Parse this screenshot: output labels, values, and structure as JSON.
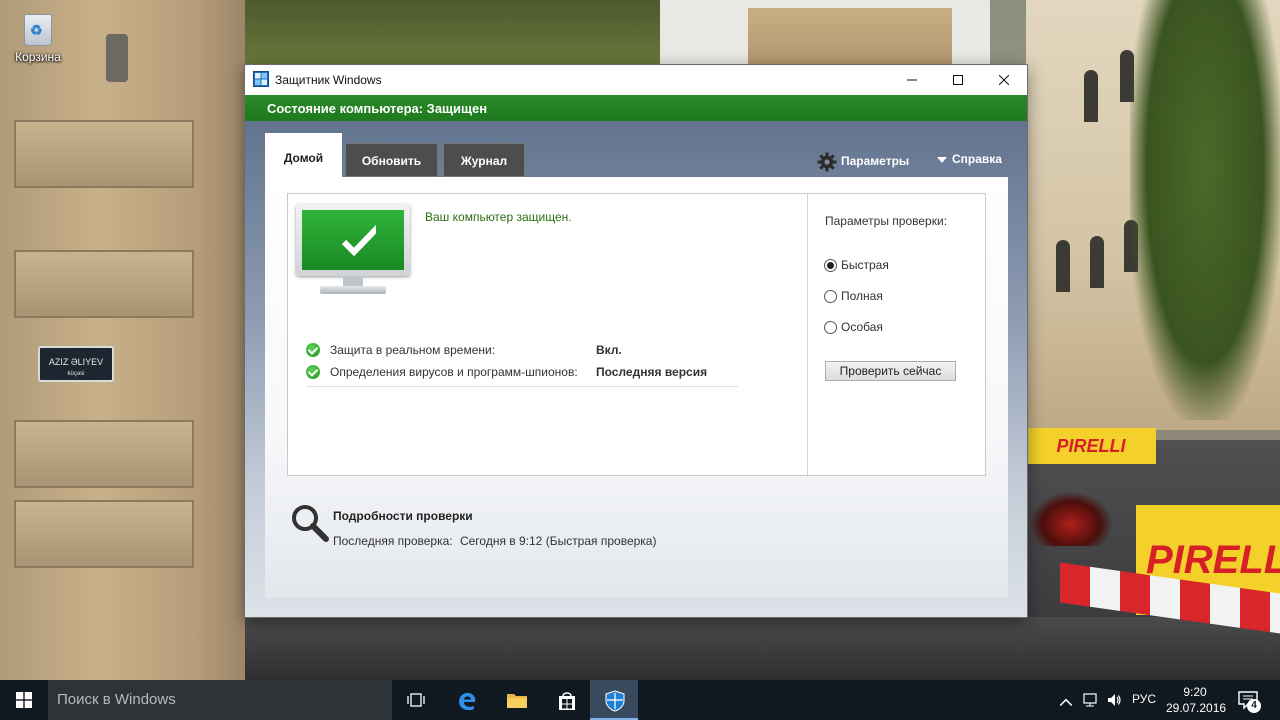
{
  "desktop": {
    "recycle_bin_label": "Корзина",
    "wallpaper_sign": "AZIZ ƏLIYEV",
    "wallpaper_sign_sub": "küçəsi",
    "wallpaper_brand": "PIRELLI"
  },
  "window": {
    "title": "Защитник Windows",
    "status_text": "Состояние компьютера: Защищен",
    "status_color": "#1f7a1e",
    "tabs": [
      {
        "label": "Домой",
        "active": true
      },
      {
        "label": "Обновить",
        "active": false
      },
      {
        "label": "Журнал",
        "active": false
      }
    ],
    "settings_label": "Параметры",
    "help_label": "Справка",
    "protected_message": "Ваш компьютер защищен.",
    "status_rows": [
      {
        "label": "Защита в реальном времени:",
        "value": "Вкл."
      },
      {
        "label": "Определения вирусов и программ-шпионов:",
        "value": "Последняя версия"
      }
    ],
    "scan_options": {
      "title": "Параметры проверки:",
      "options": [
        {
          "label": "Быстрая",
          "selected": true
        },
        {
          "label": "Полная",
          "selected": false
        },
        {
          "label": "Особая",
          "selected": false
        }
      ],
      "scan_button": "Проверить сейчас"
    },
    "scan_details": {
      "title": "Подробности проверки",
      "last_scan_label": "Последняя проверка:",
      "last_scan_value": "Сегодня в 9:12 (Быстрая проверка)"
    }
  },
  "taskbar": {
    "search_placeholder": "Поиск в Windows",
    "apps": [
      "task-view-icon",
      "edge-icon",
      "file-explorer-icon",
      "store-icon",
      "defender-icon"
    ],
    "language": "РУС",
    "time": "9:20",
    "date": "29.07.2016",
    "notification_count": "4"
  }
}
